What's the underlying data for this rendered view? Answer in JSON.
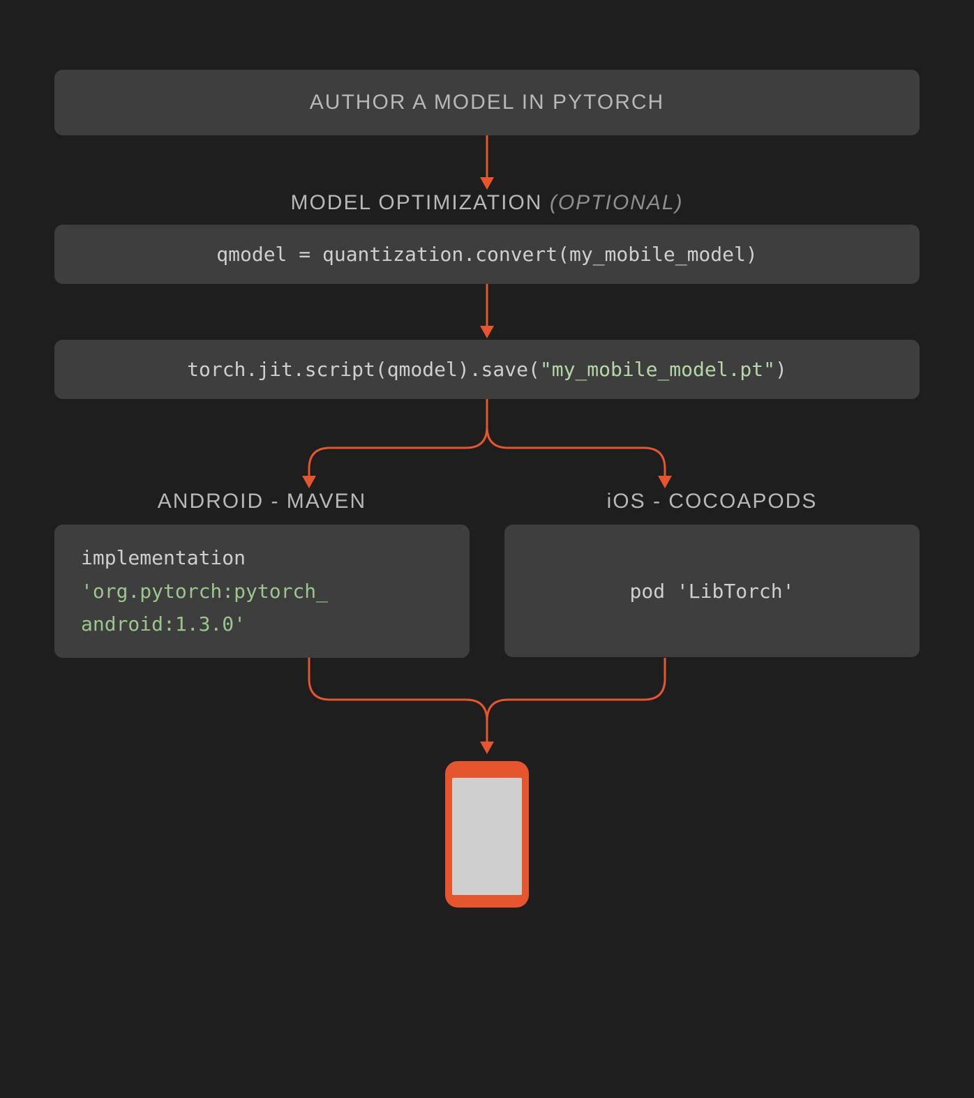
{
  "steps": {
    "author": "AUTHOR A MODEL IN PYTORCH",
    "optimization_label": "MODEL OPTIMIZATION",
    "optimization_optional": "(OPTIONAL)",
    "quantize_code": "qmodel = quantization.convert(my_mobile_model)",
    "script_code_prefix": "torch.jit.script(qmodel).save(",
    "script_code_str": "\"my_mobile_model.pt\"",
    "script_code_suffix": ")"
  },
  "forks": {
    "android": {
      "label": "ANDROID - MAVEN",
      "code_line1": "implementation",
      "code_line2": "'org.pytorch:pytorch_",
      "code_line3": "android:1.3.0'"
    },
    "ios": {
      "label": "iOS - COCOAPODS",
      "code_prefix": "pod ",
      "code_str": "'LibTorch'"
    }
  },
  "colors": {
    "accent": "#e5562f",
    "box_bg": "#3e3e3e",
    "page_bg": "#1e1e1e"
  }
}
